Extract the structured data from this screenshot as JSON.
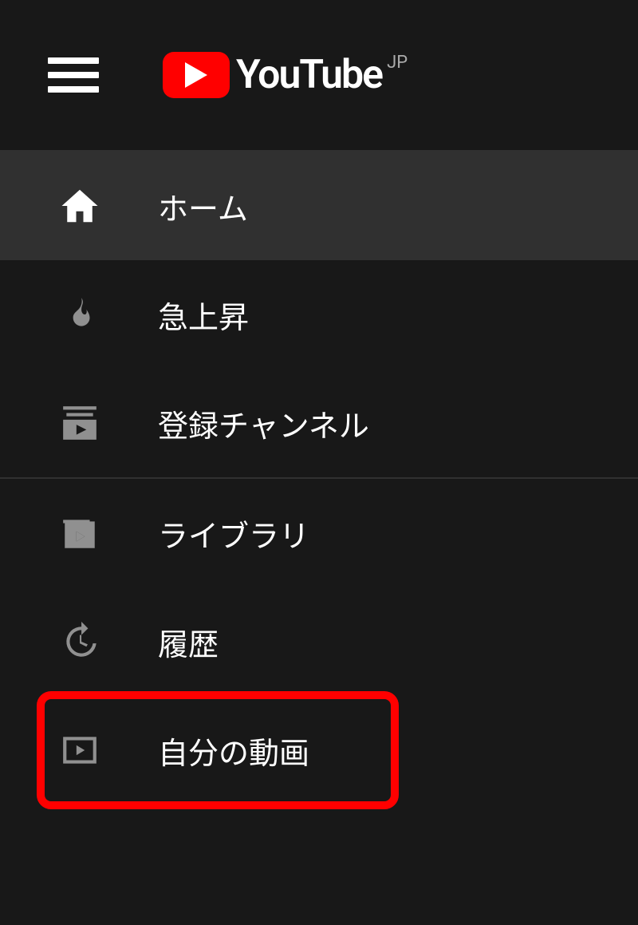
{
  "header": {
    "brand_word": "YouTube",
    "region": "JP"
  },
  "sidebar": {
    "section1": [
      {
        "icon": "home-icon",
        "label": "ホーム",
        "active": true
      },
      {
        "icon": "trending-icon",
        "label": "急上昇",
        "active": false
      },
      {
        "icon": "subscriptions-icon",
        "label": "登録チャンネル",
        "active": false
      }
    ],
    "section2": [
      {
        "icon": "library-icon",
        "label": "ライブラリ",
        "active": false
      },
      {
        "icon": "history-icon",
        "label": "履歴",
        "active": false,
        "highlighted": true
      },
      {
        "icon": "your-videos-icon",
        "label": "自分の動画",
        "active": false
      }
    ]
  }
}
